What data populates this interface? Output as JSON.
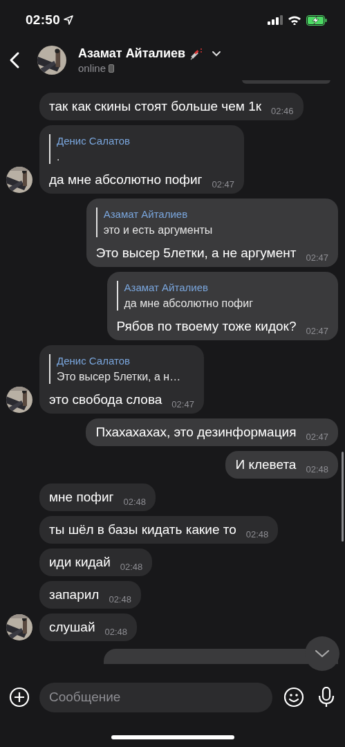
{
  "status_bar": {
    "time": "02:50"
  },
  "header": {
    "name": "Азамат Айталиев",
    "status": "online"
  },
  "messages": [
    {
      "kind": "partial",
      "outgoing": true
    },
    {
      "kind": "message",
      "outgoing": false,
      "avatar": false,
      "text": "так как скины стоят больше чем 1к",
      "time": "02:46"
    },
    {
      "kind": "message",
      "outgoing": false,
      "avatar": true,
      "reply": {
        "author": "Денис Салатов",
        "text": "."
      },
      "text": "да мне абсолютно пофиг",
      "time": "02:47"
    },
    {
      "kind": "message",
      "outgoing": true,
      "reply": {
        "author": "Азамат Айталиев",
        "text": "это и есть аргументы"
      },
      "text": "Это высер 5летки, а не аргумент",
      "time": "02:47"
    },
    {
      "kind": "message",
      "outgoing": true,
      "reply": {
        "author": "Азамат Айталиев",
        "text": "да мне абсолютно пофиг"
      },
      "text": "Рябов по твоему тоже кидок?",
      "time": "02:47"
    },
    {
      "kind": "message",
      "outgoing": false,
      "avatar": true,
      "reply": {
        "author": "Денис Салатов",
        "text": "Это высер 5летки, а н…"
      },
      "text": "это свобода слова",
      "time": "02:47"
    },
    {
      "kind": "message",
      "outgoing": true,
      "text": "Пхахахахах, это дезинформация",
      "time": "02:47"
    },
    {
      "kind": "message",
      "outgoing": true,
      "text": "И клевета",
      "time": "02:48"
    },
    {
      "kind": "message",
      "outgoing": false,
      "avatar": false,
      "text": "мне пофиг",
      "time": "02:48"
    },
    {
      "kind": "message",
      "outgoing": false,
      "avatar": false,
      "text": "ты шёл в базы кидать какие то",
      "time": "02:48"
    },
    {
      "kind": "message",
      "outgoing": false,
      "avatar": false,
      "text": "иди кидай",
      "time": "02:48"
    },
    {
      "kind": "message",
      "outgoing": false,
      "avatar": false,
      "text": "запарил",
      "time": "02:48"
    },
    {
      "kind": "message",
      "outgoing": false,
      "avatar": true,
      "text": "слушай",
      "time": "02:48"
    },
    {
      "kind": "partial",
      "outgoing": true
    }
  ],
  "composer": {
    "placeholder": "Сообщение"
  }
}
